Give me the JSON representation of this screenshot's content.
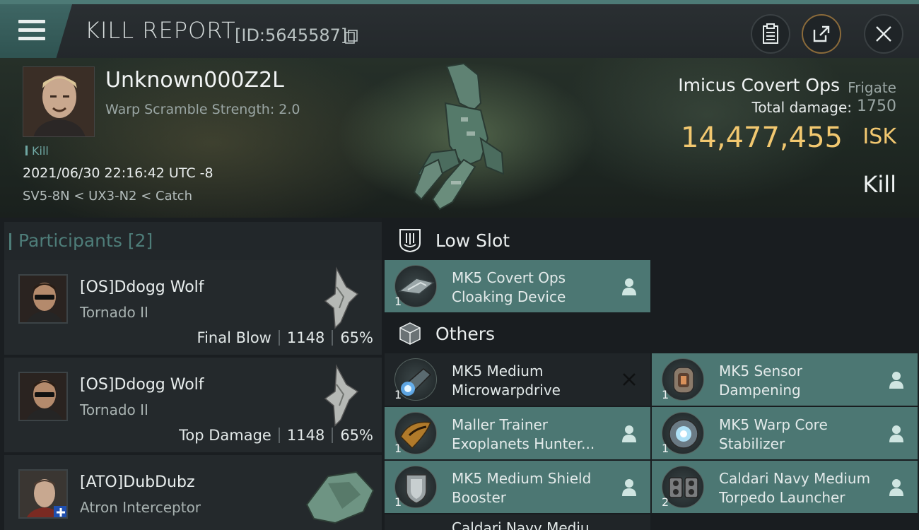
{
  "header": {
    "title": "KILL REPORT",
    "report_id": "[ID:5645587]",
    "menu_icon": "hamburger-icon",
    "buttons": [
      "clipboard-icon",
      "share-icon",
      "close-icon"
    ]
  },
  "victim": {
    "name": "Unknown000Z2L",
    "subtitle": "Warp Scramble Strength: 2.0",
    "tag": "Kill",
    "datetime": "2021/06/30 22:16:42 UTC -8",
    "location": "SV5-8N < UX3-N2 < Catch",
    "ship_name": "Imicus Covert Ops",
    "ship_class": "Frigate",
    "total_damage_label": "Total damage:",
    "total_damage": "1750",
    "isk_value": "14,477,455",
    "isk_unit": "ISK",
    "outcome": "Kill"
  },
  "participants": {
    "heading": "Participants [2]",
    "items": [
      {
        "name": "[OS]Ddogg Wolf",
        "ship": "Tornado II",
        "role": "Final Blow",
        "damage": "1148",
        "percent": "65%"
      },
      {
        "name": "[OS]Ddogg Wolf",
        "ship": "Tornado II",
        "role": "Top Damage",
        "damage": "1148",
        "percent": "65%"
      },
      {
        "name": "[ATO]DubDubz",
        "ship": "Atron Interceptor"
      }
    ]
  },
  "sections": {
    "low_slot": {
      "title": "Low Slot",
      "items": [
        {
          "line1": "MK5 Covert Ops",
          "line2": "Cloaking Device",
          "qty": "1",
          "status": "dropped"
        }
      ]
    },
    "others": {
      "title": "Others",
      "items": [
        {
          "line1": "MK5 Medium",
          "line2": "Microwarpdrive",
          "qty": "1",
          "status": "destroyed"
        },
        {
          "line1": "MK5 Sensor",
          "line2": "Dampening",
          "qty": "1",
          "status": "dropped"
        },
        {
          "line1": "Maller Trainer",
          "line2": "Exoplanets Hunter...",
          "qty": "1",
          "status": "dropped"
        },
        {
          "line1": "MK5 Warp Core",
          "line2": "Stabilizer",
          "qty": "1",
          "status": "dropped"
        },
        {
          "line1": "MK5 Medium Shield",
          "line2": "Booster",
          "qty": "1",
          "status": "dropped"
        },
        {
          "line1": "Caldari Navy Medium",
          "line2": "Torpedo Launcher",
          "qty": "2",
          "status": "dropped"
        },
        {
          "line1": "Caldari Navy Mediu",
          "line2": "",
          "qty": "",
          "status": ""
        }
      ]
    }
  },
  "colors": {
    "accent_teal": "#4c7773",
    "isk_gold": "#f2c870",
    "panel_dark": "#202528"
  }
}
